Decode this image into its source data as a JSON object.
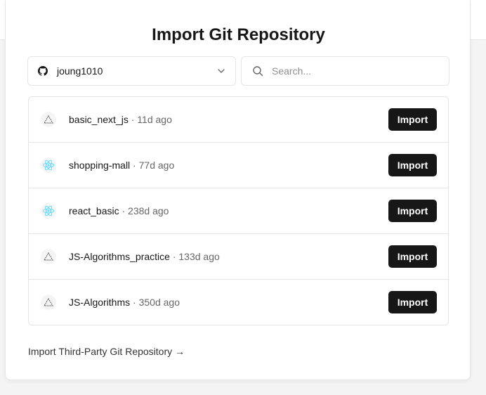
{
  "title": "Import Git Repository",
  "account": {
    "name": "joung1010",
    "icon": "github-icon"
  },
  "search": {
    "placeholder": "Search...",
    "value": ""
  },
  "repos": [
    {
      "name": "basic_next_js",
      "sep": " · ",
      "age": "11d ago",
      "framework": "nextjs",
      "button": "Import"
    },
    {
      "name": "shopping-mall",
      "sep": " · ",
      "age": "77d ago",
      "framework": "react",
      "button": "Import"
    },
    {
      "name": "react_basic",
      "sep": " · ",
      "age": "238d ago",
      "framework": "react",
      "button": "Import"
    },
    {
      "name": "JS-Algorithms_practice",
      "sep": " · ",
      "age": "133d ago",
      "framework": "nextjs",
      "button": "Import"
    },
    {
      "name": "JS-Algorithms",
      "sep": " · ",
      "age": "350d ago",
      "framework": "nextjs",
      "button": "Import"
    }
  ],
  "third_party_link": "Import Third-Party Git Repository →",
  "colors": {
    "button_bg": "#171717",
    "react": "#61dafb",
    "border": "#e5e5e5"
  }
}
